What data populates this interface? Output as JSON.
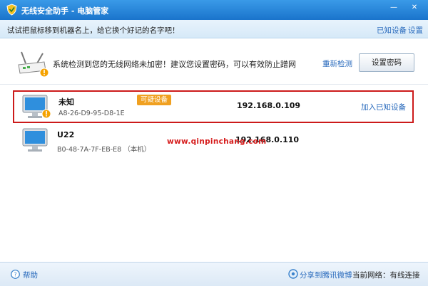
{
  "window": {
    "title": "无线安全助手 - 电脑管家",
    "minimize_glyph": "—",
    "close_glyph": "✕"
  },
  "infobar": {
    "hint": "试试把鼠标移到机器名上，给它换个好记的名字吧！",
    "known_devices_link": "已知设备",
    "settings_link": "设置"
  },
  "warning": {
    "icon": "router-warning-icon",
    "message": "系统检测到您的无线网络未加密！建议您设置密码，可以有效防止蹭网",
    "recheck_link": "重新检测",
    "set_password_button": "设置密码"
  },
  "devices": [
    {
      "name": "未知",
      "mac": "A8-26-D9-95-D8-1E",
      "badge": "可疑设备",
      "ip": "192.168.0.109",
      "action": "加入已知设备",
      "icon": "computer-warning-icon"
    },
    {
      "name": "U22",
      "mac": "B0-48-7A-7F-EB-E8 （本机）",
      "ip": "192.168.0.110",
      "icon": "computer-icon"
    }
  ],
  "watermark": "www.qinpinchang.com",
  "footer": {
    "help": "帮助",
    "share": "分享到腾讯微博",
    "network_status": "当前网络：有线连接"
  },
  "colors": {
    "title_bar": "#1a74cc",
    "link": "#2a6bbd",
    "highlight_border": "#cc1a1a",
    "badge": "#f0a020",
    "watermark": "#d61c1c"
  }
}
